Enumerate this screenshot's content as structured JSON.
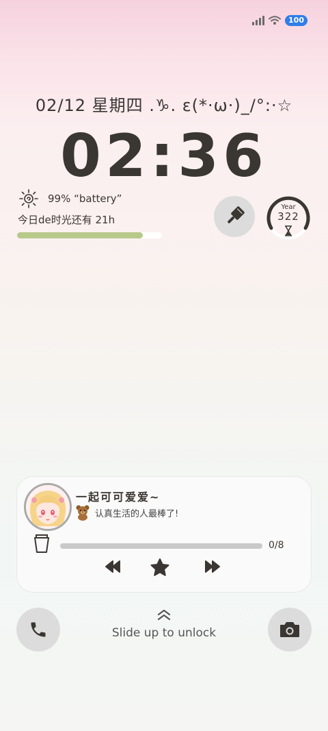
{
  "status_bar": {
    "battery_level": "100",
    "signal_bars": 4
  },
  "lock_screen": {
    "date_line": "02/12 星期四 .♑. ε(*·ω·)_/°:·☆",
    "time": "02:36",
    "battery_text": "99% “battery”",
    "daylight_text": "今日de时光还有 21h",
    "daylight_progress": 0.87,
    "year_label": "Year",
    "year_value": "322",
    "unlock_text": "Slide up to unlock"
  },
  "music": {
    "title": "一起可可爱爱~",
    "subtitle": "认真生活的人最棒了!",
    "track_count": "0/8",
    "progress": 0
  },
  "colors": {
    "progress_fill": "#b8c98a",
    "battery_badge": "#2f7de8",
    "text_dark": "#3a3632"
  },
  "icons": [
    "signal-icon",
    "wifi-icon",
    "sun-icon",
    "brush-icon",
    "hourglass-icon",
    "cup-icon",
    "prev-icon",
    "star-icon",
    "next-icon",
    "phone-icon",
    "camera-icon",
    "chevron-up-icon"
  ]
}
